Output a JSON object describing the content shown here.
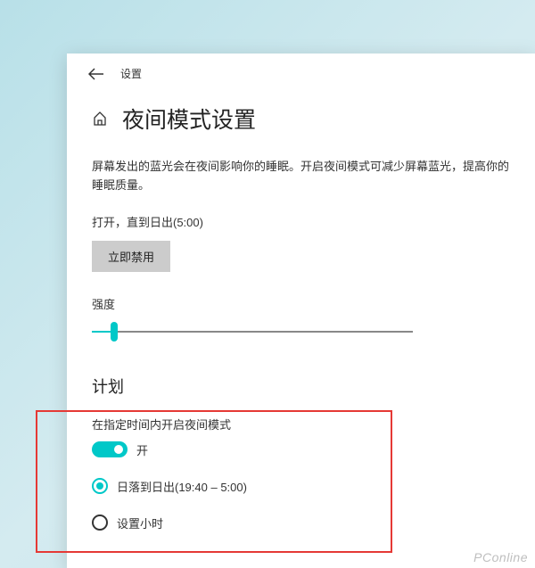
{
  "titlebar": {
    "label": "设置"
  },
  "header": {
    "title": "夜间模式设置"
  },
  "description": "屏幕发出的蓝光会在夜间影响你的睡眠。开启夜间模式可减少屏幕蓝光，提高你的睡眠质量。",
  "status": {
    "label": "打开，直到日出(5:00)",
    "disable_button": "立即禁用"
  },
  "intensity": {
    "label": "强度"
  },
  "schedule": {
    "section_title": "计划",
    "enable_label": "在指定时间内开启夜间模式",
    "toggle_state": "开",
    "options": {
      "sunset": "日落到日出(19:40 – 5:00)",
      "custom": "设置小时"
    }
  },
  "watermark": "PConline"
}
